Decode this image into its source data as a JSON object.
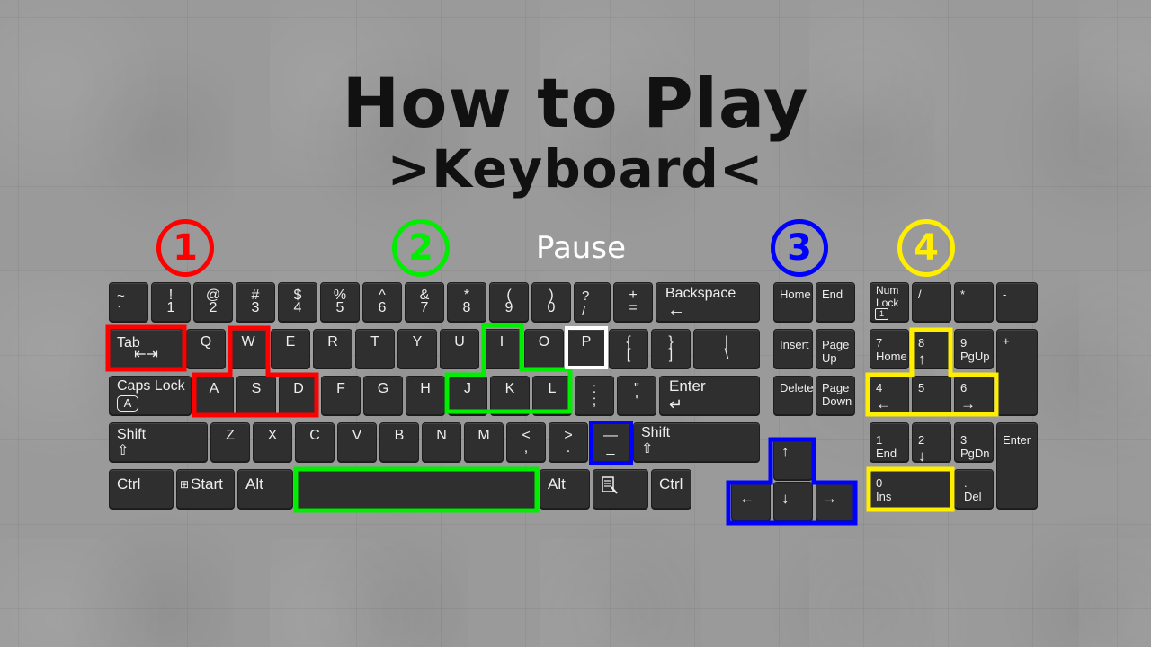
{
  "title": "How to Play",
  "subtitle": ">Keyboard<",
  "pause_label": "Pause",
  "sections": [
    {
      "num": "1",
      "color": "#ff0000"
    },
    {
      "num": "2",
      "color": "#00ee00"
    },
    {
      "num": "3",
      "color": "#0000ff"
    },
    {
      "num": "4",
      "color": "#ffee00"
    }
  ],
  "keys": {
    "row1": [
      {
        "top": "~",
        "bottom": "`"
      },
      {
        "top": "!",
        "bottom": "1"
      },
      {
        "top": "@",
        "bottom": "2"
      },
      {
        "top": "#",
        "bottom": "3"
      },
      {
        "top": "$",
        "bottom": "4"
      },
      {
        "top": "%",
        "bottom": "5"
      },
      {
        "top": "^",
        "bottom": "6"
      },
      {
        "top": "&",
        "bottom": "7"
      },
      {
        "top": "*",
        "bottom": "8"
      },
      {
        "top": "(",
        "bottom": "9"
      },
      {
        "top": ")",
        "bottom": "0"
      },
      {
        "top": "?",
        "bottom": "/"
      },
      {
        "top": "+",
        "bottom": "="
      },
      {
        "top": "Backspace",
        "bottom": "←"
      }
    ],
    "tab": "Tab",
    "row2": [
      "Q",
      "W",
      "E",
      "R",
      "T",
      "Y",
      "U",
      "I",
      "O",
      "P"
    ],
    "row2_sym": [
      {
        "top": "{",
        "bottom": "["
      },
      {
        "top": "}",
        "bottom": "]"
      },
      {
        "top": "|",
        "bottom": "\\"
      }
    ],
    "caps": "Caps Lock",
    "caps_letter": "A",
    "row3": [
      "A",
      "S",
      "D",
      "F",
      "G",
      "H",
      "J",
      "K",
      "L"
    ],
    "row3_sym": [
      {
        "top": ":",
        "bottom": ";"
      },
      {
        "top": "\"",
        "bottom": "'"
      }
    ],
    "enter": "Enter",
    "shift": "Shift",
    "shift_arrow": "⇧",
    "row4": [
      "Z",
      "X",
      "C",
      "V",
      "B",
      "N",
      "M"
    ],
    "row4_sym": [
      {
        "top": "<",
        "bottom": ","
      },
      {
        "top": ">",
        "bottom": "."
      },
      {
        "top": "—",
        "bottom": "_"
      }
    ],
    "ctrl": "Ctrl",
    "start": "Start",
    "start_icon": "windows-icon",
    "alt": "Alt",
    "menu_icon": "context-menu-icon",
    "nav": {
      "home": "Home",
      "end": "End",
      "insert": "Insert",
      "pageup": [
        "Page",
        "Up"
      ],
      "delete": "Delete",
      "pagedown": [
        "Page",
        "Down"
      ]
    },
    "arrows": {
      "up": "↑",
      "down": "↓",
      "left": "←",
      "right": "→"
    },
    "numpad": {
      "numlock": [
        "Num",
        "Lock",
        "1"
      ],
      "slash": "/",
      "star": "*",
      "minus": "-",
      "plus": "+",
      "n7": [
        "7",
        "Home"
      ],
      "n8": [
        "8",
        "↑"
      ],
      "n9": [
        "9",
        "PgUp"
      ],
      "n4": [
        "4",
        "←"
      ],
      "n5": "5",
      "n6": [
        "6",
        "→"
      ],
      "n1": [
        "1",
        "End"
      ],
      "n2": [
        "2",
        "↓"
      ],
      "n3": [
        "3",
        "PgDn"
      ],
      "n0": [
        "0",
        "Ins"
      ],
      "dot": [
        ".",
        "Del"
      ],
      "enter": "Enter"
    }
  }
}
